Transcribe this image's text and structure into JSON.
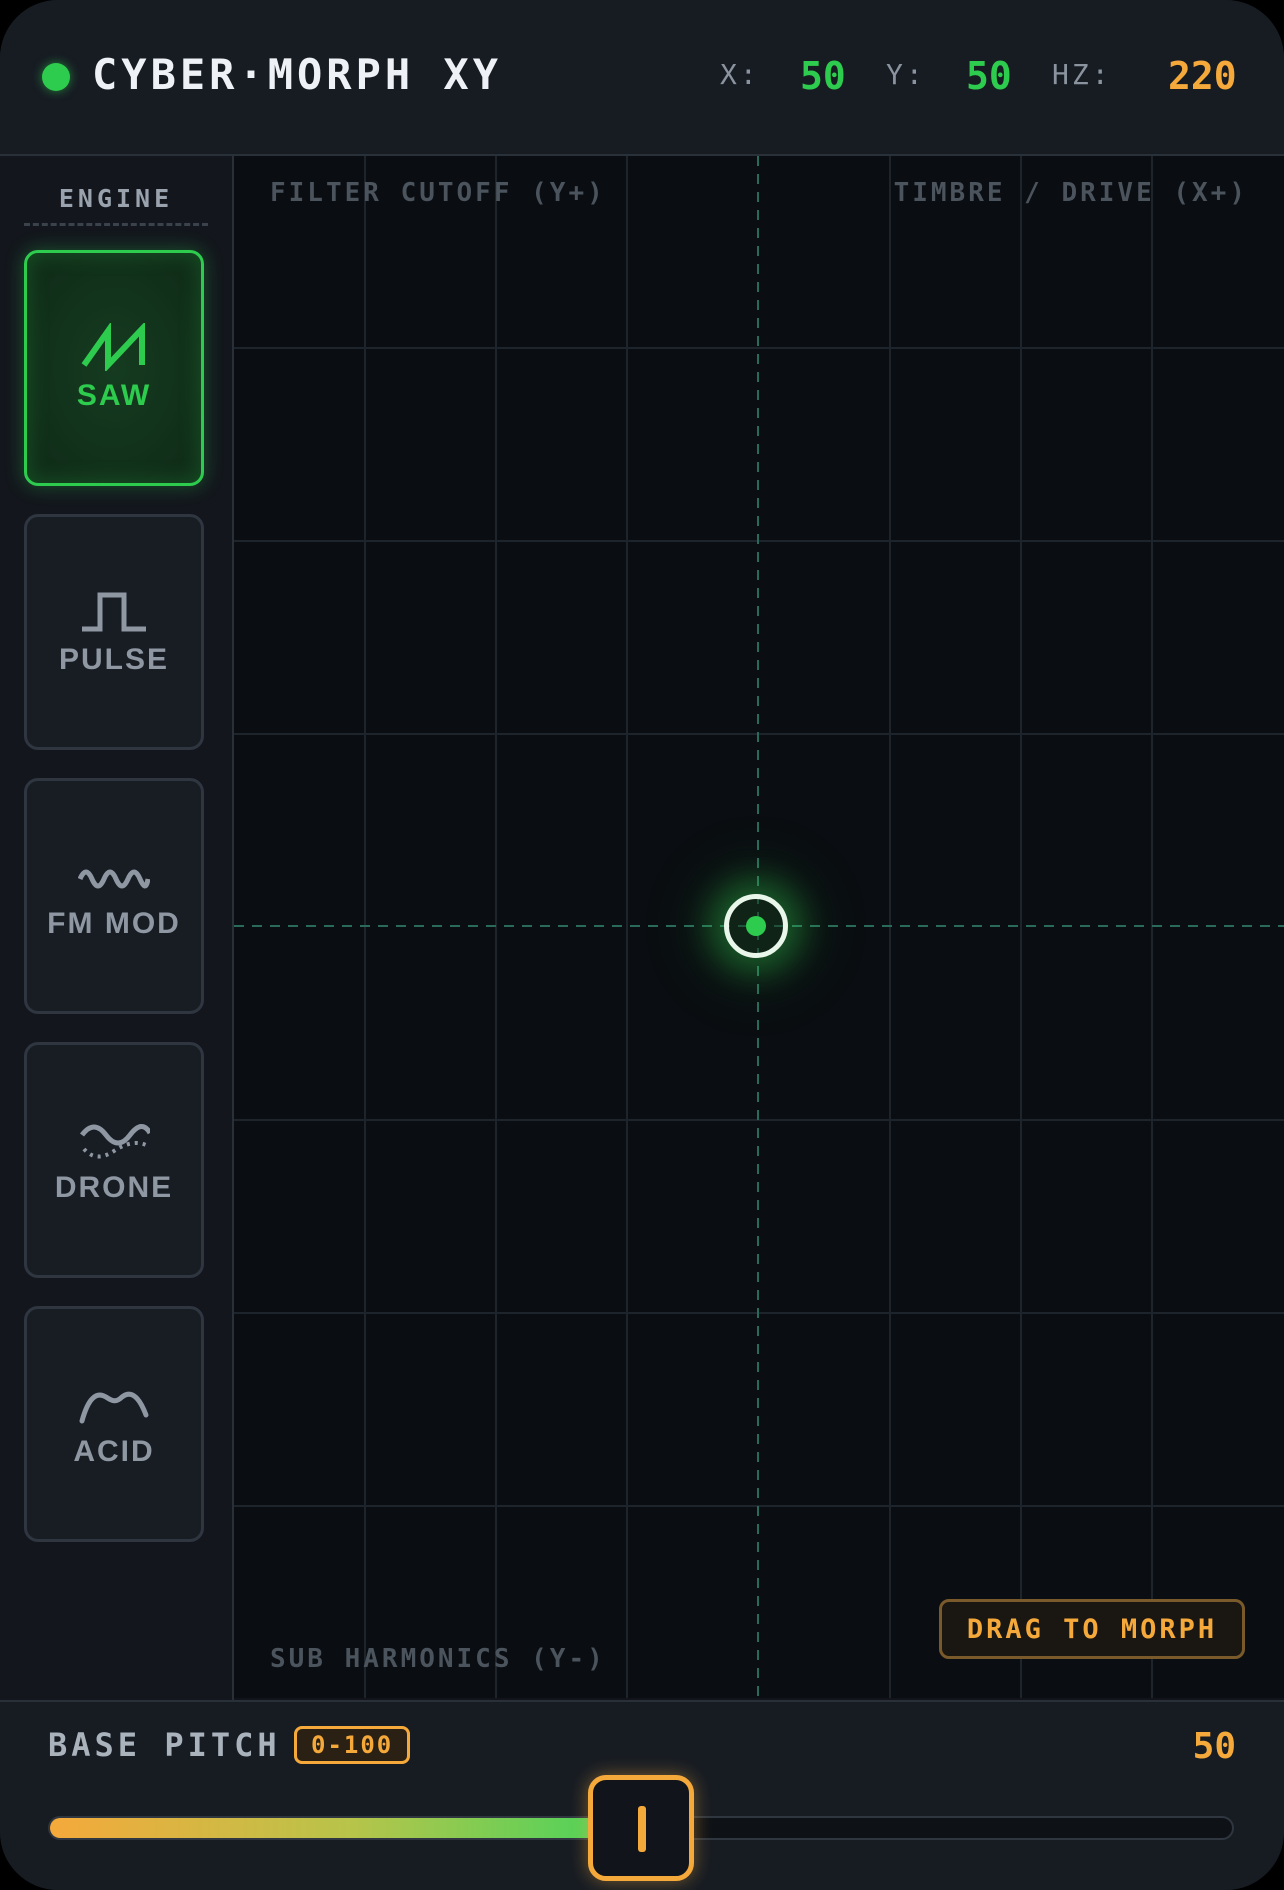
{
  "app": {
    "title": "CYBER·MORPH XY"
  },
  "readouts": {
    "x_label": "X:",
    "x_value": "50",
    "y_label": "Y:",
    "y_value": "50",
    "hz_label": "HZ:",
    "hz_value": "220"
  },
  "sidebar": {
    "heading": "ENGINE",
    "engines": [
      {
        "label": "SAW",
        "icon": "saw-wave-icon",
        "active": true
      },
      {
        "label": "PULSE",
        "icon": "pulse-wave-icon",
        "active": false
      },
      {
        "label": "FM MOD",
        "icon": "fm-wave-icon",
        "active": false
      },
      {
        "label": "DRONE",
        "icon": "drone-wave-icon",
        "active": false
      },
      {
        "label": "ACID",
        "icon": "acid-wave-icon",
        "active": false
      }
    ]
  },
  "pad": {
    "top_left_label": "FILTER CUTOFF (Y+)",
    "top_right_label": "TIMBRE / DRIVE (X+)",
    "bottom_left_label": "SUB HARMONICS (Y-)",
    "hint": "DRAG TO MORPH",
    "puck": {
      "x": 50,
      "y": 50
    }
  },
  "pitch": {
    "label": "BASE PITCH",
    "range": "0-100",
    "value": "50",
    "level": 50
  },
  "colors": {
    "accent_green": "#2ecc4e",
    "accent_orange": "#f5a93b",
    "background": "#11151b"
  }
}
